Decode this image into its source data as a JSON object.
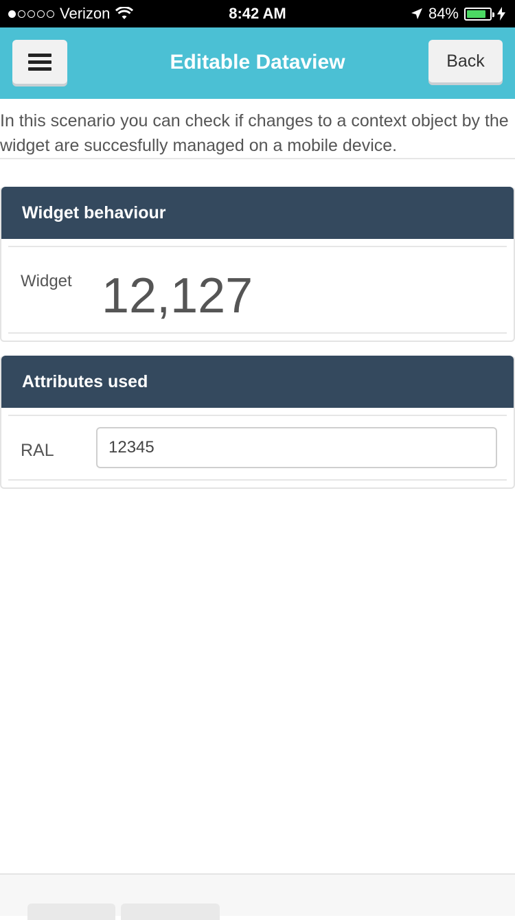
{
  "status_bar": {
    "carrier": "Verizon",
    "time": "8:42 AM",
    "battery": "84%",
    "battery_level": 0.84
  },
  "header": {
    "title": "Editable Dataview",
    "back_label": "Back"
  },
  "description": "In this scenario you can check if changes to a context object by the widget are succesfully managed on a mobile device.",
  "widget_panel": {
    "title": "Widget behaviour",
    "label": "Widget",
    "value": "12,127"
  },
  "attributes_panel": {
    "title": "Attributes used",
    "ral_label": "RAL",
    "ral_value": "12345"
  },
  "colors": {
    "header": "#4bc0d4",
    "panel_header": "#34495e",
    "battery": "#4cd964"
  }
}
